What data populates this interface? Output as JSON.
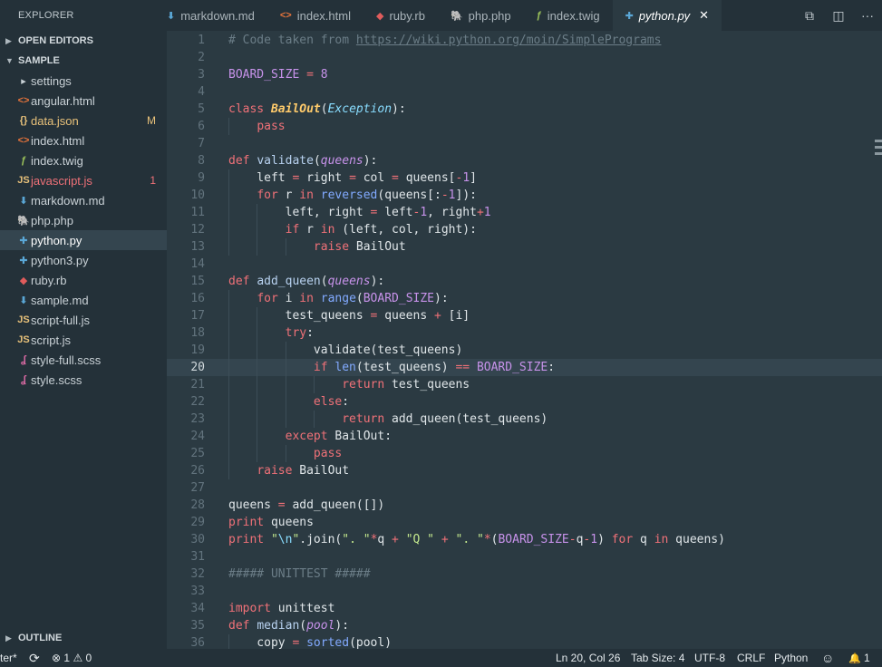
{
  "sidebar": {
    "title": "EXPLORER",
    "open_editors": {
      "arrow": "▶",
      "label": "OPEN EDITORS"
    },
    "sample": {
      "arrow": "▼",
      "label": "SAMPLE"
    },
    "files": [
      {
        "icon": "▸",
        "icon_name": "folder-chevron-icon",
        "color": "#c9d1d6",
        "label": "settings"
      },
      {
        "icon": "<>",
        "icon_name": "html-icon",
        "color": "#e8743b",
        "label": "angular.html"
      },
      {
        "icon": "{}",
        "icon_name": "json-icon",
        "color": "#e8c17a",
        "label": "data.json",
        "badge": "M",
        "state": "modified"
      },
      {
        "icon": "<>",
        "icon_name": "html-icon",
        "color": "#e8743b",
        "label": "index.html"
      },
      {
        "icon": "ƒ",
        "icon_name": "twig-icon",
        "color": "#9bc25a",
        "label": "index.twig"
      },
      {
        "icon": "JS",
        "icon_name": "javascript-icon",
        "color": "#e8c17a",
        "label": "javascript.js",
        "badge": "1",
        "state": "error"
      },
      {
        "icon": "⬇",
        "icon_name": "markdown-icon",
        "color": "#5aa7d6",
        "label": "markdown.md"
      },
      {
        "icon": "🐘",
        "icon_name": "php-icon",
        "color": "#a78bd6",
        "label": "php.php"
      },
      {
        "icon": "✚",
        "icon_name": "python-icon",
        "color": "#5aa7d6",
        "label": "python.py",
        "state": "active"
      },
      {
        "icon": "✚",
        "icon_name": "python-icon",
        "color": "#5aa7d6",
        "label": "python3.py"
      },
      {
        "icon": "◆",
        "icon_name": "ruby-icon",
        "color": "#e05c5c",
        "label": "ruby.rb"
      },
      {
        "icon": "⬇",
        "icon_name": "markdown-icon",
        "color": "#5aa7d6",
        "label": "sample.md"
      },
      {
        "icon": "JS",
        "icon_name": "javascript-icon",
        "color": "#e8c17a",
        "label": "script-full.js"
      },
      {
        "icon": "JS",
        "icon_name": "javascript-icon",
        "color": "#e8c17a",
        "label": "script.js"
      },
      {
        "icon": "ʆ",
        "icon_name": "scss-icon",
        "color": "#d96aa3",
        "label": "style-full.scss"
      },
      {
        "icon": "ʆ",
        "icon_name": "scss-icon",
        "color": "#d96aa3",
        "label": "style.scss"
      }
    ],
    "outline": {
      "arrow": "▶",
      "label": "OUTLINE"
    }
  },
  "tabs": [
    {
      "icon": "⬇",
      "icon_name": "markdown-icon",
      "color": "#5aa7d6",
      "label": "markdown.md"
    },
    {
      "icon": "<>",
      "icon_name": "html-icon",
      "color": "#e8743b",
      "label": "index.html"
    },
    {
      "icon": "◆",
      "icon_name": "ruby-icon",
      "color": "#e05c5c",
      "label": "ruby.rb"
    },
    {
      "icon": "🐘",
      "icon_name": "php-icon",
      "color": "#a78bd6",
      "label": "php.php"
    },
    {
      "icon": "ƒ",
      "icon_name": "twig-icon",
      "color": "#9bc25a",
      "label": "index.twig"
    },
    {
      "icon": "✚",
      "icon_name": "python-icon",
      "color": "#5aa7d6",
      "label": "python.py",
      "active": true,
      "close": "✕"
    }
  ],
  "tab_actions": [
    {
      "icon": "⧉",
      "name": "compare-changes-icon"
    },
    {
      "icon": "◫",
      "name": "split-editor-icon"
    },
    {
      "icon": "···",
      "name": "more-actions-icon"
    }
  ],
  "editor": {
    "current_line": 20,
    "lines": [
      [
        [
          "cm",
          "# Code taken from "
        ],
        [
          "url",
          "https://wiki.python.org/moin/SimplePrograms"
        ]
      ],
      [],
      [
        [
          "cst",
          "BOARD_SIZE"
        ],
        [
          "pl",
          " "
        ],
        [
          "op",
          "="
        ],
        [
          "pl",
          " "
        ],
        [
          "num",
          "8"
        ]
      ],
      [],
      [
        [
          "kw",
          "class"
        ],
        [
          "pl",
          " "
        ],
        [
          "cls",
          "BailOut"
        ],
        [
          "pl",
          "("
        ],
        [
          "inh",
          "Exception"
        ],
        [
          "pl",
          "):"
        ]
      ],
      [
        [
          "pl",
          "    "
        ],
        [
          "kw",
          "pass"
        ]
      ],
      [],
      [
        [
          "kw",
          "def"
        ],
        [
          "pl",
          " "
        ],
        [
          "fn",
          "validate"
        ],
        [
          "pl",
          "("
        ],
        [
          "prm",
          "queens"
        ],
        [
          "pl",
          "):"
        ]
      ],
      [
        [
          "pl",
          "    left "
        ],
        [
          "op",
          "="
        ],
        [
          "pl",
          " right "
        ],
        [
          "op",
          "="
        ],
        [
          "pl",
          " col "
        ],
        [
          "op",
          "="
        ],
        [
          "pl",
          " queens["
        ],
        [
          "op",
          "-"
        ],
        [
          "num",
          "1"
        ],
        [
          "pl",
          "]"
        ]
      ],
      [
        [
          "pl",
          "    "
        ],
        [
          "kw",
          "for"
        ],
        [
          "pl",
          " r "
        ],
        [
          "kw",
          "in"
        ],
        [
          "pl",
          " "
        ],
        [
          "bi",
          "reversed"
        ],
        [
          "pl",
          "(queens[:"
        ],
        [
          "op",
          "-"
        ],
        [
          "num",
          "1"
        ],
        [
          "pl",
          "]):"
        ]
      ],
      [
        [
          "pl",
          "        left, right "
        ],
        [
          "op",
          "="
        ],
        [
          "pl",
          " left"
        ],
        [
          "op",
          "-"
        ],
        [
          "num",
          "1"
        ],
        [
          "pl",
          ", right"
        ],
        [
          "op",
          "+"
        ],
        [
          "num",
          "1"
        ]
      ],
      [
        [
          "pl",
          "        "
        ],
        [
          "kw",
          "if"
        ],
        [
          "pl",
          " r "
        ],
        [
          "kw",
          "in"
        ],
        [
          "pl",
          " (left, col, right):"
        ]
      ],
      [
        [
          "pl",
          "            "
        ],
        [
          "kw",
          "raise"
        ],
        [
          "pl",
          " BailOut"
        ]
      ],
      [],
      [
        [
          "kw",
          "def"
        ],
        [
          "pl",
          " "
        ],
        [
          "fn",
          "add_queen"
        ],
        [
          "pl",
          "("
        ],
        [
          "prm",
          "queens"
        ],
        [
          "pl",
          "):"
        ]
      ],
      [
        [
          "pl",
          "    "
        ],
        [
          "kw",
          "for"
        ],
        [
          "pl",
          " i "
        ],
        [
          "kw",
          "in"
        ],
        [
          "pl",
          " "
        ],
        [
          "bi",
          "range"
        ],
        [
          "pl",
          "("
        ],
        [
          "cst",
          "BOARD_SIZE"
        ],
        [
          "pl",
          "):"
        ]
      ],
      [
        [
          "pl",
          "        test_queens "
        ],
        [
          "op",
          "="
        ],
        [
          "pl",
          " queens "
        ],
        [
          "op",
          "+"
        ],
        [
          "pl",
          " [i]"
        ]
      ],
      [
        [
          "pl",
          "        "
        ],
        [
          "kw",
          "try"
        ],
        [
          "pl",
          ":"
        ]
      ],
      [
        [
          "pl",
          "            validate(test_queens)"
        ]
      ],
      [
        [
          "pl",
          "            "
        ],
        [
          "kw",
          "if"
        ],
        [
          "pl",
          " "
        ],
        [
          "bi",
          "len"
        ],
        [
          "pl",
          "(test_queens) "
        ],
        [
          "op",
          "=="
        ],
        [
          "pl",
          " "
        ],
        [
          "cst",
          "BOARD_SIZE"
        ],
        [
          "pl",
          ":"
        ]
      ],
      [
        [
          "pl",
          "                "
        ],
        [
          "kw",
          "return"
        ],
        [
          "pl",
          " test_queens"
        ]
      ],
      [
        [
          "pl",
          "            "
        ],
        [
          "kw",
          "else"
        ],
        [
          "pl",
          ":"
        ]
      ],
      [
        [
          "pl",
          "                "
        ],
        [
          "kw",
          "return"
        ],
        [
          "pl",
          " add_queen(test_queens)"
        ]
      ],
      [
        [
          "pl",
          "        "
        ],
        [
          "kw",
          "except"
        ],
        [
          "pl",
          " BailOut:"
        ]
      ],
      [
        [
          "pl",
          "            "
        ],
        [
          "kw",
          "pass"
        ]
      ],
      [
        [
          "pl",
          "    "
        ],
        [
          "kw",
          "raise"
        ],
        [
          "pl",
          " BailOut"
        ]
      ],
      [],
      [
        [
          "pl",
          "queens "
        ],
        [
          "op",
          "="
        ],
        [
          "pl",
          " add_queen([])"
        ]
      ],
      [
        [
          "kw",
          "print"
        ],
        [
          "pl",
          " queens"
        ]
      ],
      [
        [
          "kw",
          "print"
        ],
        [
          "pl",
          " "
        ],
        [
          "str",
          "\""
        ],
        [
          "esc",
          "\\n"
        ],
        [
          "str",
          "\""
        ],
        [
          "pl",
          ".join("
        ],
        [
          "str",
          "\". \""
        ],
        [
          "op",
          "*"
        ],
        [
          "pl",
          "q "
        ],
        [
          "op",
          "+"
        ],
        [
          "pl",
          " "
        ],
        [
          "str",
          "\"Q \""
        ],
        [
          "pl",
          " "
        ],
        [
          "op",
          "+"
        ],
        [
          "pl",
          " "
        ],
        [
          "str",
          "\". \""
        ],
        [
          "op",
          "*"
        ],
        [
          "pl",
          "("
        ],
        [
          "cst",
          "BOARD_SIZE"
        ],
        [
          "op",
          "-"
        ],
        [
          "pl",
          "q"
        ],
        [
          "op",
          "-"
        ],
        [
          "num",
          "1"
        ],
        [
          "pl",
          ") "
        ],
        [
          "kw",
          "for"
        ],
        [
          "pl",
          " q "
        ],
        [
          "kw",
          "in"
        ],
        [
          "pl",
          " queens)"
        ]
      ],
      [],
      [
        [
          "cm",
          "##### UNITTEST #####"
        ]
      ],
      [],
      [
        [
          "kw",
          "import"
        ],
        [
          "pl",
          " unittest"
        ]
      ],
      [
        [
          "kw",
          "def"
        ],
        [
          "pl",
          " "
        ],
        [
          "fn",
          "median"
        ],
        [
          "pl",
          "("
        ],
        [
          "prm",
          "pool"
        ],
        [
          "pl",
          "):"
        ]
      ],
      [
        [
          "pl",
          "    copy "
        ],
        [
          "op",
          "="
        ],
        [
          "pl",
          " "
        ],
        [
          "bi",
          "sorted"
        ],
        [
          "pl",
          "(pool)"
        ]
      ]
    ]
  },
  "status": {
    "branch": "ter*",
    "sync_icon": "⟳",
    "errors_icon": "⊗",
    "errors": "1",
    "warnings_icon": "⚠",
    "warnings": "0",
    "position": "Ln 20, Col 26",
    "tab_size": "Tab Size: 4",
    "encoding": "UTF-8",
    "eol": "CRLF",
    "language": "Python",
    "feedback_icon": "☺",
    "notifications_icon": "🔔",
    "notifications": "1"
  }
}
